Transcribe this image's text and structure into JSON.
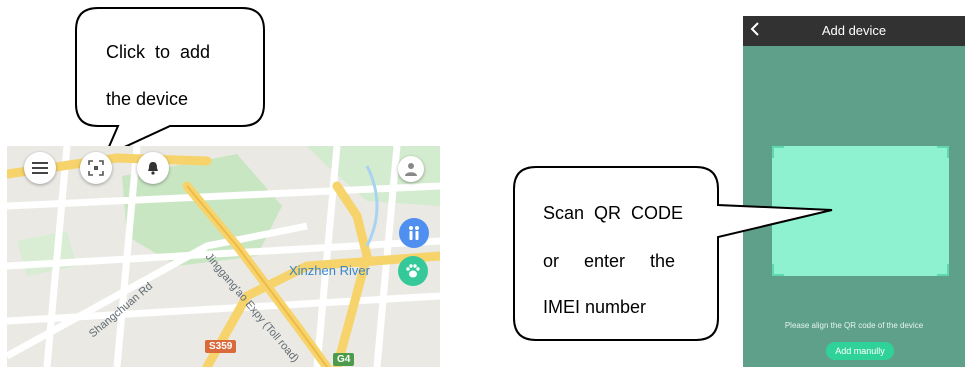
{
  "callout_add": {
    "line1": "Click  to  add",
    "line2": "the device"
  },
  "map": {
    "labels": {
      "expressway": "Jinggang'ao Expy (Toll road)",
      "river": "Xinzhen River",
      "road": "Shangchuan Rd"
    },
    "shields": {
      "s359": "S359",
      "g4": "G4"
    },
    "icons": {
      "menu": "menu-icon",
      "scan": "scan-icon",
      "alarm": "bell-icon",
      "profile": "person-icon",
      "family": "family-icon",
      "pet": "paw-icon"
    },
    "colors": {
      "road_major": "#f7d36b",
      "road_minor": "#ffffff",
      "park": "#c9e6c3",
      "family_fab": "#4f8ff0",
      "pet_fab": "#35c99a"
    }
  },
  "callout_scan": {
    "line1": "Scan  QR  CODE",
    "line2": "or     enter     the",
    "line3": "IMEI number"
  },
  "phone": {
    "title": "Add device",
    "back_icon": "back-arrow-icon",
    "hint": "Please align the QR code of the device",
    "manual_button": "Add manully",
    "colors": {
      "background": "#5ea08a",
      "header": "#323232",
      "scan_area": "#8ef1cf",
      "button": "#2fd39a"
    }
  }
}
